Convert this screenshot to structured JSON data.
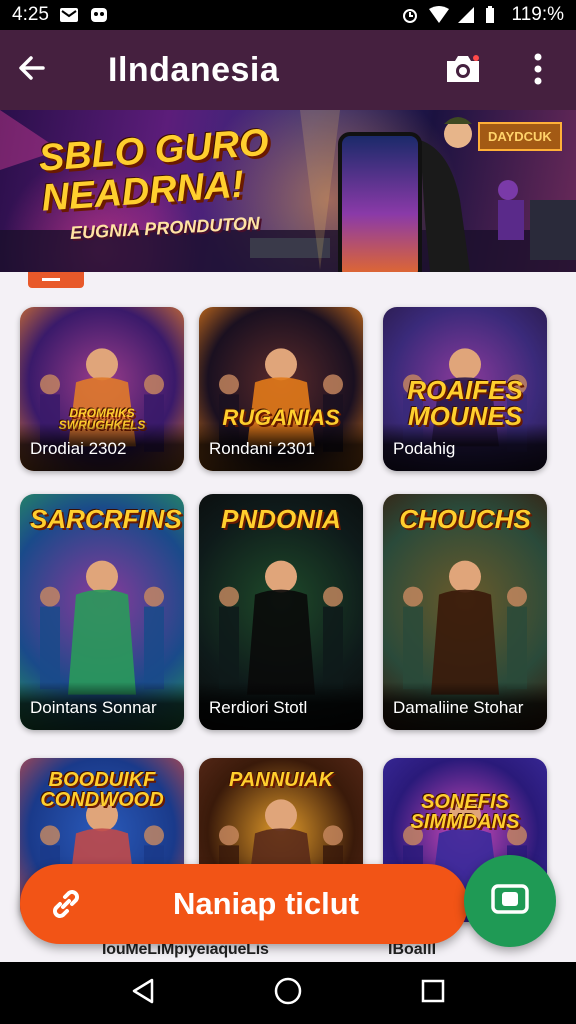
{
  "status_bar": {
    "time": "4:25",
    "battery": "119:%"
  },
  "app_bar": {
    "title": "Ilndanesia"
  },
  "banner": {
    "headline_line1": "SBLO GURO",
    "headline_line2": "NEADRNA!",
    "subtitle": "EUGNIA PRONDUTON",
    "tag": "DAYDCUK"
  },
  "cards": [
    {
      "caption": "Drodiai 2302",
      "logo": "DROMRIKS SWRUGHKELS",
      "colors": [
        "#3a1a6a",
        "#9a3c8a",
        "#e07a2a"
      ]
    },
    {
      "caption": "Rondani 2301",
      "logo": "RUGANIAS",
      "colors": [
        "#1a1020",
        "#5a2a2a",
        "#e27a1a"
      ]
    },
    {
      "caption": "Podahig",
      "logo": "ROAIFES MOUNES",
      "colors": [
        "#3a2a7a",
        "#8a3a9a",
        "#2a1a4a"
      ]
    },
    {
      "caption": "Dointans Sonnar",
      "logo": "SARCRFINS",
      "colors": [
        "#1a4a8a",
        "#8a3a9a",
        "#2a9a5a"
      ]
    },
    {
      "caption": "Rerdiori Stotl",
      "logo": "PNDONIA",
      "colors": [
        "#0e1a1a",
        "#1f4a2a",
        "#0a0a0a"
      ]
    },
    {
      "caption": "Damaliine Stohar",
      "logo": "CHOUCHS",
      "colors": [
        "#2a4a3a",
        "#6a5a2a",
        "#3a1a0a"
      ]
    },
    {
      "caption": "",
      "logo": "BOODUIKF CONDWOOD",
      "colors": [
        "#1a3a8a",
        "#2a5aba",
        "#c04a4a"
      ]
    },
    {
      "caption": "",
      "logo": "PANNUIAK",
      "colors": [
        "#3a1a0a",
        "#e09a2a",
        "#5a2a1a"
      ]
    },
    {
      "caption": "",
      "logo": "SONEFIS SIMMDANS",
      "colors": [
        "#2a1a7a",
        "#d04aba",
        "#3a2a9a"
      ]
    }
  ],
  "chip_tab": "",
  "action_button": {
    "label": "Naniap ticlut"
  },
  "bottom_strip": {
    "text_left": "IouMeLiMpiyeiaqueLis",
    "text_right": "IBoallI"
  },
  "colors": {
    "app_bar": "#45203f",
    "primary_action": "#f25416",
    "secondary_action": "#1f9a55"
  },
  "icons": {
    "back": "arrow-left-icon",
    "camera": "camera-icon",
    "more": "more-vert-icon",
    "link": "link-icon",
    "screenshot": "screenshot-icon",
    "nav_back": "triangle-back-icon",
    "nav_home": "circle-home-icon",
    "nav_recents": "square-recents-icon"
  }
}
